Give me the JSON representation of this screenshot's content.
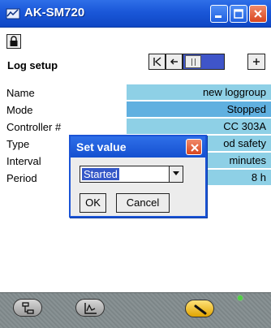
{
  "window": {
    "title": "AK-SM720",
    "icons": [
      "app-icon",
      "minimize-icon",
      "maximize-icon",
      "close-icon"
    ]
  },
  "toolbar": {
    "lock_icon": "lock-icon"
  },
  "page": {
    "title": "Log setup",
    "nav": {
      "first_icon": "first-page-icon",
      "prev_icon": "previous-page-icon",
      "next_icon": "next-page-icon"
    }
  },
  "rows": [
    {
      "label": "Name",
      "value": "new loggroup"
    },
    {
      "label": "Mode",
      "value": "Stopped"
    },
    {
      "label": "Controller #",
      "value": "CC 303A"
    },
    {
      "label": "Type",
      "value": "od safety"
    },
    {
      "label": "Interval",
      "value": "minutes"
    },
    {
      "label": "Period",
      "value": "8 h"
    }
  ],
  "dialog": {
    "title": "Set value",
    "selected_value": "Started",
    "ok_label": "OK",
    "cancel_label": "Cancel"
  },
  "bottombar": {
    "icons": [
      "network-icon",
      "graph-icon",
      "service-tool-icon"
    ],
    "status": "online",
    "status_color": "#4fd040"
  },
  "colors": {
    "titlebar": "#1a57d8",
    "row_value": "#8ed0e6",
    "row_value_dark": "#60b0e0"
  }
}
